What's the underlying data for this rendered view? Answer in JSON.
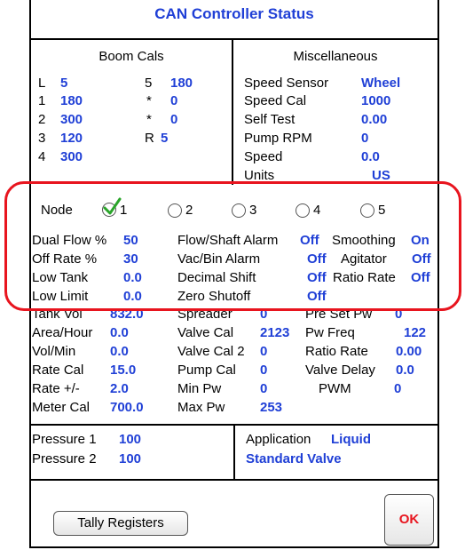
{
  "title": "CAN Controller Status",
  "boom_cals": {
    "heading": "Boom Cals",
    "left": [
      {
        "label": "L",
        "value": "5"
      },
      {
        "label": "1",
        "value": "180"
      },
      {
        "label": "2",
        "value": "300"
      },
      {
        "label": "3",
        "value": "120"
      },
      {
        "label": "4",
        "value": "300"
      }
    ],
    "right": [
      {
        "label": "5",
        "value": "180"
      },
      {
        "label": "*",
        "value": "0"
      },
      {
        "label": "*",
        "value": "0"
      },
      {
        "label": "R",
        "value": "5"
      }
    ]
  },
  "misc": {
    "heading": "Miscellaneous",
    "rows": [
      {
        "label": "Speed Sensor",
        "value": "Wheel"
      },
      {
        "label": "Speed Cal",
        "value": "1000"
      },
      {
        "label": "Self Test",
        "value": "0.00"
      },
      {
        "label": "Pump RPM",
        "value": "0"
      },
      {
        "label": "Speed",
        "value": "0.0"
      },
      {
        "label": "Units",
        "value": "US"
      }
    ]
  },
  "node": {
    "label": "Node",
    "options": [
      "1",
      "2",
      "3",
      "4",
      "5"
    ],
    "selected": "1"
  },
  "node_settings": {
    "col1": [
      {
        "label": "Dual Flow %",
        "value": "50"
      },
      {
        "label": "Off Rate %",
        "value": "30"
      },
      {
        "label": "Low Tank",
        "value": "0.0"
      },
      {
        "label": "Low Limit",
        "value": "0.0"
      }
    ],
    "col2": [
      {
        "label": "Flow/Shaft Alarm",
        "value": "Off"
      },
      {
        "label": "Vac/Bin Alarm",
        "value": "Off"
      },
      {
        "label": "Decimal Shift",
        "value": "Off"
      },
      {
        "label": "Zero Shutoff",
        "value": "Off"
      }
    ],
    "col3": [
      {
        "label": "Smoothing",
        "value": "On"
      },
      {
        "label": "Agitator",
        "value": "Off"
      },
      {
        "label": "Ratio Rate",
        "value": "Off"
      }
    ]
  },
  "lower": {
    "col1": [
      {
        "label": "Tank Vol",
        "value": "832.0"
      },
      {
        "label": "Area/Hour",
        "value": "0.0"
      },
      {
        "label": "Vol/Min",
        "value": "0.0"
      },
      {
        "label": "Rate Cal",
        "value": "15.0"
      },
      {
        "label": "Rate +/-",
        "value": "2.0"
      },
      {
        "label": "Meter Cal",
        "value": "700.0"
      }
    ],
    "col2": [
      {
        "label": "Spreader",
        "value": "0"
      },
      {
        "label": "Valve Cal",
        "value": "2123"
      },
      {
        "label": "Valve Cal 2",
        "value": "0"
      },
      {
        "label": "Pump Cal",
        "value": "0"
      },
      {
        "label": "Min Pw",
        "value": "0"
      },
      {
        "label": "Max Pw",
        "value": "253"
      }
    ],
    "col3": [
      {
        "label": "Pre Set Pw",
        "value": "0"
      },
      {
        "label": "Pw Freq",
        "value": "122"
      },
      {
        "label": "Ratio Rate",
        "value": "0.00"
      },
      {
        "label": "Valve Delay",
        "value": "0.0"
      },
      {
        "label": "PWM",
        "value": "0"
      }
    ]
  },
  "pressure": [
    {
      "label": "Pressure 1",
      "value": "100"
    },
    {
      "label": "Pressure 2",
      "value": "100"
    }
  ],
  "application": {
    "label": "Application",
    "value": "Liquid",
    "valve": "Standard Valve"
  },
  "buttons": {
    "tally": "Tally Registers",
    "ok": "OK"
  },
  "colors": {
    "value": "#1f3fd6",
    "highlight": "#e8141e",
    "ok_text": "#e8141e",
    "check": "#2aa52a"
  }
}
